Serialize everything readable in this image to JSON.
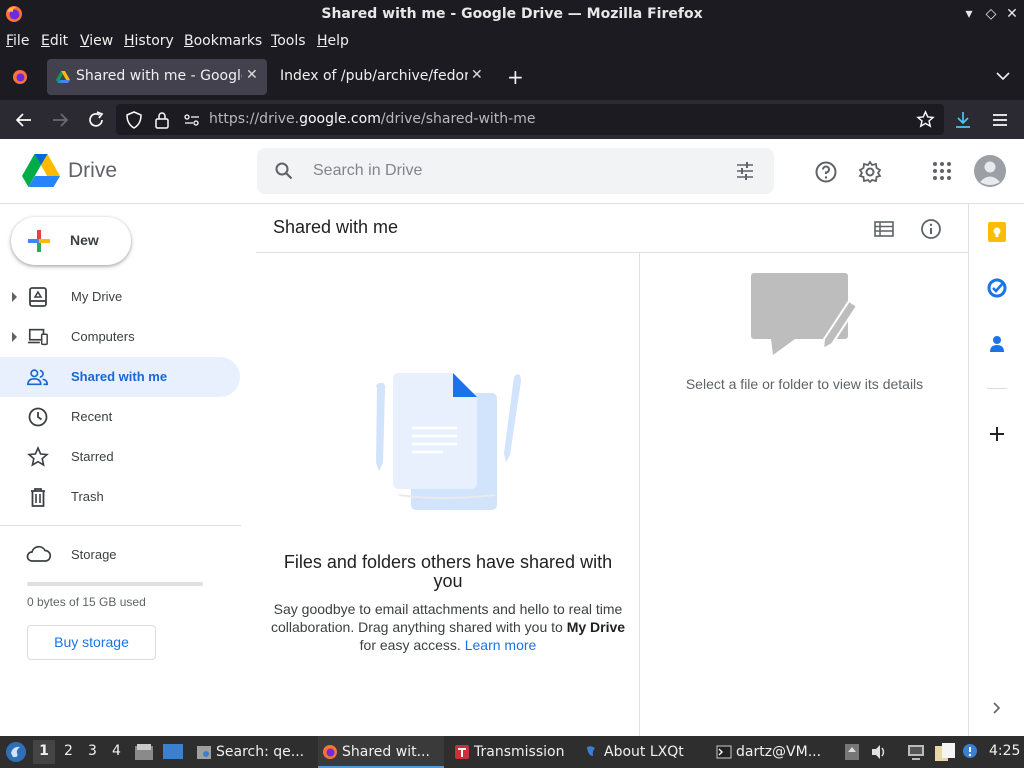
{
  "window": {
    "title": "Shared with me - Google Drive — Mozilla Firefox",
    "minimize": "▾",
    "restore": "◇",
    "close": "✕"
  },
  "menu": [
    "File",
    "Edit",
    "View",
    "History",
    "Bookmarks",
    "Tools",
    "Help"
  ],
  "tabs": [
    {
      "label": "Shared with me - Google",
      "close": "✕",
      "active": true
    },
    {
      "label": "Index of /pub/archive/fedora",
      "close": "✕",
      "active": false
    }
  ],
  "tabbar": {
    "new_tab": "+",
    "list_all": "⌄"
  },
  "urlbar": {
    "prefix": "https://drive.",
    "domain": "google.com",
    "path": "/drive/shared-with-me"
  },
  "drive": {
    "name": "Drive",
    "search_placeholder": "Search in Drive"
  },
  "sidebar": {
    "new_label": "New",
    "items": [
      {
        "label": "My Drive",
        "icon": "my-drive-icon"
      },
      {
        "label": "Computers",
        "icon": "computers-icon"
      },
      {
        "label": "Shared with me",
        "icon": "shared-icon",
        "active": true
      },
      {
        "label": "Recent",
        "icon": "clock-icon"
      },
      {
        "label": "Starred",
        "icon": "star-icon"
      },
      {
        "label": "Trash",
        "icon": "trash-icon"
      }
    ],
    "storage_label": "Storage",
    "storage_used_fraction": 0,
    "storage_text": "0 bytes of 15 GB used",
    "buy_storage": "Buy storage"
  },
  "main": {
    "title": "Shared with me",
    "empty_title": "Files and folders others have shared with you",
    "empty_desc_1": "Say goodbye to email attachments and hello to real time collaboration. Drag anything shared with you to ",
    "empty_desc_bold": "My Drive",
    "empty_desc_2": " for easy access. ",
    "learn_more": "Learn more",
    "details_text": "Select a file or folder to view its details"
  },
  "taskbar": {
    "workspaces": [
      "1",
      "2",
      "3",
      "4"
    ],
    "tasks": [
      {
        "label": "Search: qe...",
        "icon": "search-tool-icon"
      },
      {
        "label": "Shared wit...",
        "icon": "firefox-icon",
        "active": true
      },
      {
        "label": "Transmission",
        "icon": "transmission-icon"
      },
      {
        "label": "About LXQt",
        "icon": "lxqt-icon"
      },
      {
        "label": "dartz@VM...",
        "icon": "terminal-icon"
      }
    ],
    "clock": "4:25"
  },
  "colors": {
    "accent": "#1a73e8",
    "active_nav_bg": "#e8f0fe",
    "titlebar_bg": "#1c1b22"
  }
}
